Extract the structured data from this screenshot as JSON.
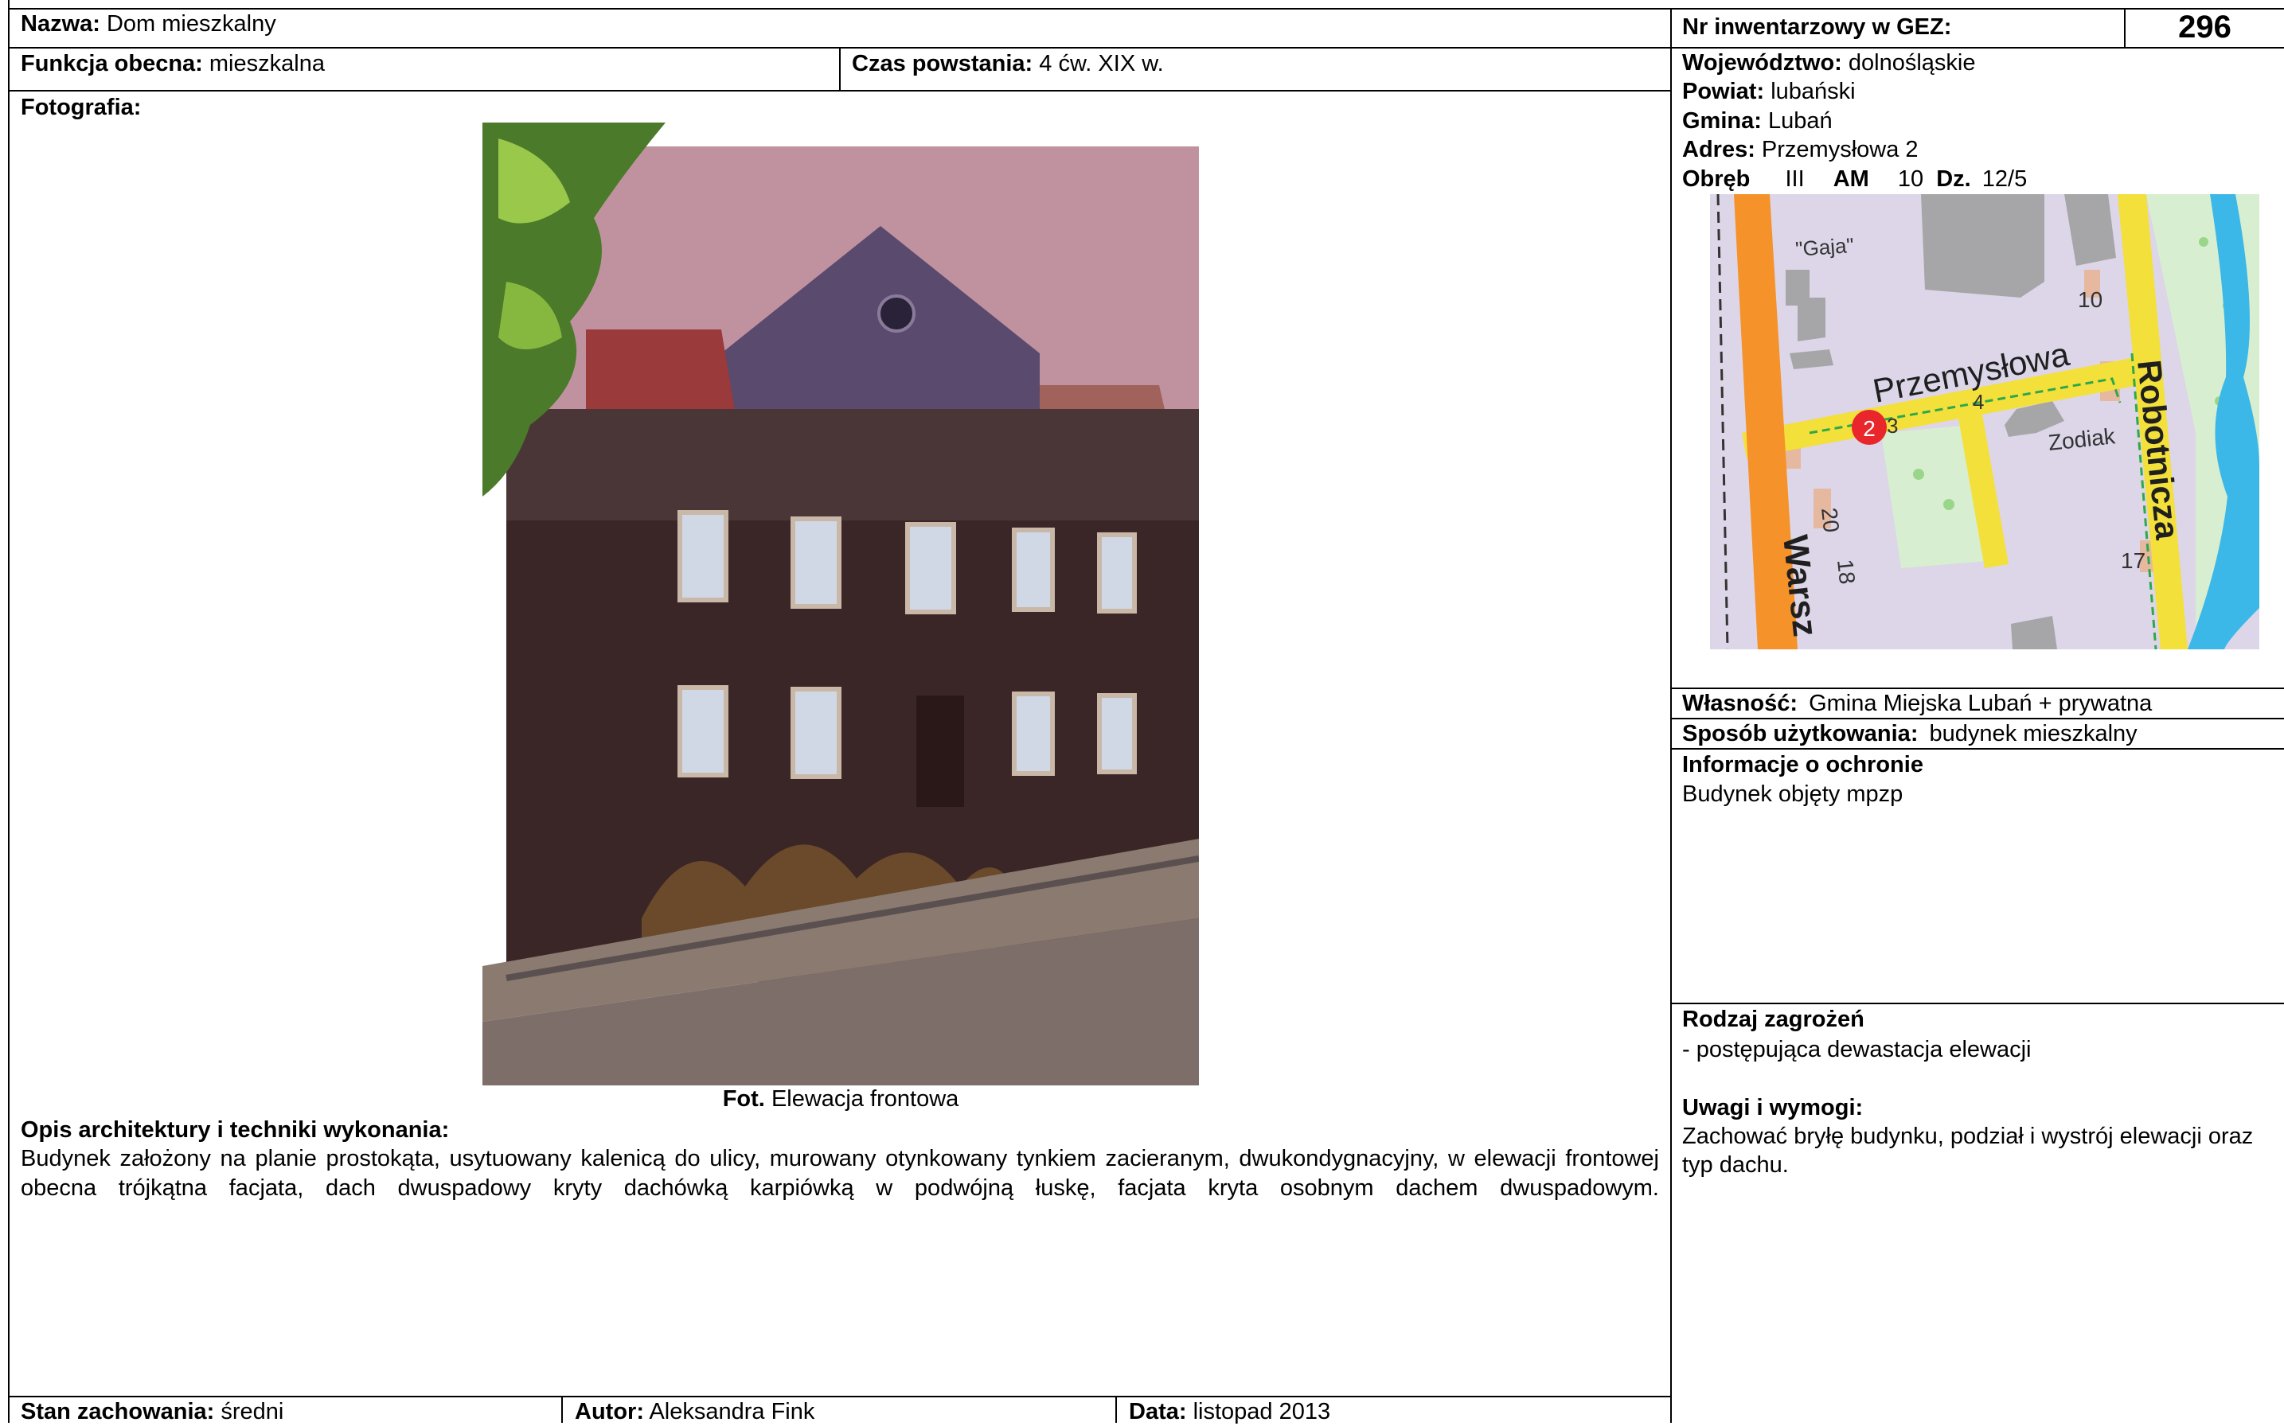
{
  "header": {
    "name_label": "Nazwa:",
    "name_value": "Dom mieszkalny",
    "inventory_label": "Nr inwentarzowy w GEZ:",
    "inventory_number": "296"
  },
  "row2": {
    "function_label": "Funkcja obecna:",
    "function_value": "mieszkalna",
    "period_label": "Czas powstania:",
    "period_value": "4 ćw. XIX w."
  },
  "location": {
    "voivodeship_label": "Województwo:",
    "voivodeship_value": "dolnośląskie",
    "county_label": "Powiat:",
    "county_value": "lubański",
    "commune_label": "Gmina:",
    "commune_value": "Lubań",
    "address_label": "Adres:",
    "address_value": "Przemysłowa 2",
    "precinct_label": "Obręb",
    "precinct_value": "III",
    "am_label": "AM",
    "am_value": "10",
    "plot_label": "Dz.",
    "plot_value": "12/5"
  },
  "map": {
    "street_przemyslowa": "Przemysłowa",
    "street_robotnicza": "Robotnicza",
    "street_warszawska": "Warsz",
    "place_gaja": "\"Gaja\"",
    "place_zodiak": "Zodiak",
    "marker_number": "2",
    "num_3": "3",
    "num_4": "4",
    "num_10": "10",
    "num_17": "17",
    "num_18": "18",
    "num_20": "20",
    "colors": {
      "background": "#dcd6e8",
      "main_road": "#f5922a",
      "street": "#f3e03a",
      "water": "#3bb8e8",
      "green": "#d8eed0",
      "building": "#a6a6a8",
      "marker": "#e8262b"
    }
  },
  "photo": {
    "label": "Fotografia:",
    "caption_label": "Fot.",
    "caption_value": "Elewacja frontowa"
  },
  "description": {
    "heading": "Opis architektury i techniki wykonania:",
    "text": "Budynek założony na planie prostokąta, usytuowany kalenicą do ulicy, murowany otynkowany tynkiem zacieranym, dwukondygnacyjny, w elewacji frontowej obecna trójkątna facjata, dach dwuspadowy kryty dachówką karpiówką w podwójną łuskę, facjata kryta osobnym dachem dwuspadowym."
  },
  "ownership": {
    "label": "Własność:",
    "value": "Gmina Miejska Lubań + prywatna"
  },
  "usage": {
    "label": "Sposób użytkowania:",
    "value": "budynek mieszkalny"
  },
  "protection": {
    "heading": "Informacje o ochronie",
    "text": "Budynek objęty mpzp"
  },
  "threats": {
    "heading": "Rodzaj zagrożeń",
    "text": "- postępująca dewastacja elewacji"
  },
  "remarks": {
    "heading": "Uwagi i wymogi:",
    "text": "Zachować bryłę budynku, podział i wystrój elewacji oraz typ dachu."
  },
  "footer": {
    "condition_label": "Stan zachowania:",
    "condition_value": "średni",
    "author_label": "Autor:",
    "author_value": "Aleksandra Fink",
    "date_label": "Data:",
    "date_value": "listopad 2013"
  }
}
